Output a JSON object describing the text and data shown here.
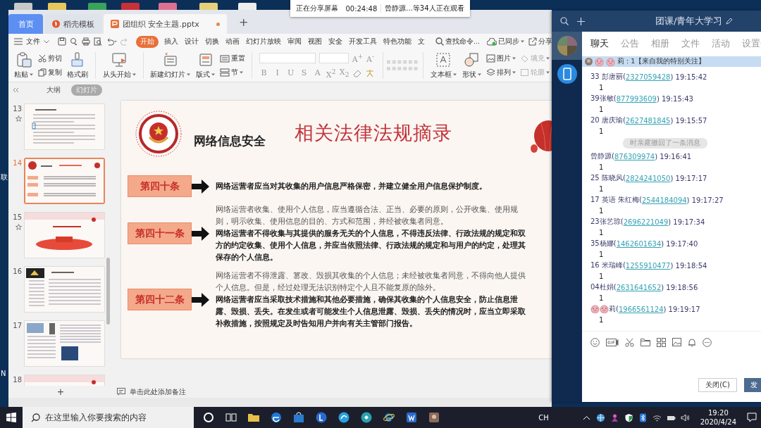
{
  "desktop": {
    "labels": [
      "联",
      "N"
    ]
  },
  "share_banner": {
    "status": "正在分享屏幕",
    "timer": "00:24:48",
    "viewers": "曾静源...等34人正在观看"
  },
  "wps": {
    "tabs": [
      {
        "kind": "home",
        "label": "首页",
        "selected": false
      },
      {
        "kind": "template",
        "label": "稻壳模板",
        "selected": false
      },
      {
        "kind": "document",
        "label": "团组织 安全主题.pptx",
        "selected": true,
        "modified": true
      }
    ],
    "new_tab": "+",
    "file_menu": "文件",
    "menu_tabs": [
      {
        "label": "开始",
        "selected": true
      },
      {
        "label": "插入",
        "selected": false
      },
      {
        "label": "设计",
        "selected": false
      },
      {
        "label": "切换",
        "selected": false
      },
      {
        "label": "动画",
        "selected": false
      },
      {
        "label": "幻灯片放映",
        "selected": false
      },
      {
        "label": "审阅",
        "selected": false
      },
      {
        "label": "视图",
        "selected": false
      },
      {
        "label": "安全",
        "selected": false
      },
      {
        "label": "开发工具",
        "selected": false
      },
      {
        "label": "特色功能",
        "selected": false
      },
      {
        "label": "文",
        "selected": false
      }
    ],
    "command_search": "查找命令...",
    "sync": "已同步",
    "share": "分享",
    "ribbon": {
      "paste": "粘贴",
      "cut": "剪切",
      "copy": "复制",
      "format_painter": "格式刷",
      "play_from_start": "从头开始",
      "new_slide": "新建幻灯片",
      "layout": "版式",
      "reset": "重置",
      "section": "节",
      "font_size_buttons": [
        "A$^{+}$",
        "A$^{-}$"
      ],
      "format_buttons": [
        "B",
        "I",
        "U",
        "S",
        "A",
        "X$^{2}$",
        "X$_{2}$"
      ],
      "text_box": "文本框",
      "shape": "形状",
      "picture": "图片",
      "arrange": "排列",
      "fill": {
        "label": "填充",
        "disabled": true
      },
      "outline": {
        "label": "轮廓",
        "disabled": true
      }
    },
    "pane_tabs": [
      {
        "label": "大纲",
        "selected": false
      },
      {
        "label": "幻灯片",
        "selected": true
      }
    ],
    "slides": [
      {
        "number": "13",
        "selected": false,
        "animated": true
      },
      {
        "number": "14",
        "selected": true,
        "animated": false
      },
      {
        "number": "15",
        "selected": false,
        "animated": true
      },
      {
        "number": "16",
        "selected": false,
        "animated": false
      },
      {
        "number": "17",
        "selected": false,
        "animated": false
      },
      {
        "number": "18",
        "selected": false,
        "animated": false
      }
    ],
    "add_slide": "+",
    "notes_placeholder": "单击此处添加备注",
    "slide": {
      "subtitle": "网络信息安全",
      "title": "相关法律法规摘录",
      "articles": [
        {
          "label": "第四十条",
          "paragraphs": [
            {
              "bold": true,
              "text": "网络运营者应当对其收集的用户信息严格保密，并建立健全用户信息保护制度。"
            }
          ]
        },
        {
          "label": "第四十一条",
          "paragraphs": [
            {
              "bold": false,
              "text": "网络运营者收集、使用个人信息，应当遵循合法、正当、必要的原则，公开收集、使用规则，明示收集、使用信息的目的、方式和范围，并经被收集者同意。"
            },
            {
              "bold": true,
              "text": "网络运营者不得收集与其提供的服务无关的个人信息，不得违反法律、行政法规的规定和双方的约定收集、使用个人信息，并应当依照法律、行政法规的规定和与用户的约定，处理其保存的个人信息。"
            }
          ]
        },
        {
          "label": "第四十二条",
          "paragraphs": [
            {
              "bold": false,
              "text": "网络运营者不得泄露、篡改、毁损其收集的个人信息；未经被收集者同意，不得向他人提供个人信息。但是，经过处理无法识别特定个人且不能复原的除外。"
            },
            {
              "bold": true,
              "text": "网络运营者应当采取技术措施和其他必要措施，确保其收集的个人信息安全，防止信息泄露、毁损、丢失。在发生或者可能发生个人信息泄露、毁损、丢失的情况时，应当立即采取补救措施，按照规定及时告知用户并向有关主管部门报告。"
            }
          ]
        }
      ]
    }
  },
  "chat": {
    "title": "团课/青年大学习",
    "tabs": [
      {
        "label": "聊天",
        "selected": true
      },
      {
        "label": "公告",
        "selected": false
      },
      {
        "label": "相册",
        "selected": false
      },
      {
        "label": "文件",
        "selected": false
      },
      {
        "label": "活动",
        "selected": false
      },
      {
        "label": "设置",
        "selected": false
      }
    ],
    "pinned": {
      "emoji": [
        {
          "kind": "pig"
        },
        {
          "kind": "pig"
        }
      ],
      "text": "莉 : 1【来自我的特别关注】"
    },
    "messages": [
      {
        "kind": "message",
        "name": "33 彭唐丽(",
        "id": "2327059428",
        "time": ") 19:15:42",
        "text": "1"
      },
      {
        "kind": "message",
        "name": "39张敏(",
        "id": "877993609",
        "time": ") 19:15:43",
        "text": "1"
      },
      {
        "kind": "message",
        "name": "20 唐庆瑜(",
        "id": "2627481845",
        "time": ") 19:15:57",
        "text": "1"
      },
      {
        "kind": "notice",
        "text": "时亲露撤回了一条消息"
      },
      {
        "kind": "message",
        "name": "曾静源(",
        "id": "876309974",
        "time": ") 19:16:41",
        "text": "1"
      },
      {
        "kind": "message",
        "name": "25 陈晓风(",
        "id": "2824241050",
        "time": ") 19:17:17",
        "text": "1"
      },
      {
        "kind": "message",
        "name": "17 英语 朱红梅(",
        "id": "2544184094",
        "time": ") 19:17:27",
        "text": "1"
      },
      {
        "kind": "message",
        "name": "23张艺琼(",
        "id": "2696221049",
        "time": ") 19:17:34",
        "text": "1"
      },
      {
        "kind": "message",
        "name": "35杨娜(",
        "id": "1462601634",
        "time": ") 19:17:40",
        "text": "1"
      },
      {
        "kind": "message",
        "name": "16 米瑞峰(",
        "id": "1255910477",
        "time": ") 19:18:54",
        "text": "1"
      },
      {
        "kind": "message",
        "name": "04杜娟(",
        "id": "2631641652",
        "time": ") 19:18:56",
        "text": "1"
      },
      {
        "kind": "message",
        "emoji": [
          {
            "kind": "pig"
          },
          {
            "kind": "pig"
          }
        ],
        "name": "莉(",
        "id": "1966561124",
        "time": ") 19:19:17",
        "text": "1"
      }
    ],
    "buttons": [
      {
        "kind": "secondary",
        "label": "关闭(C)"
      },
      {
        "kind": "primary",
        "label": "发"
      }
    ]
  },
  "taskbar": {
    "search_placeholder": "在这里输入你要搜索的内容",
    "input_indicator": "CH",
    "time": "19:20",
    "date": "2020/4/24"
  }
}
